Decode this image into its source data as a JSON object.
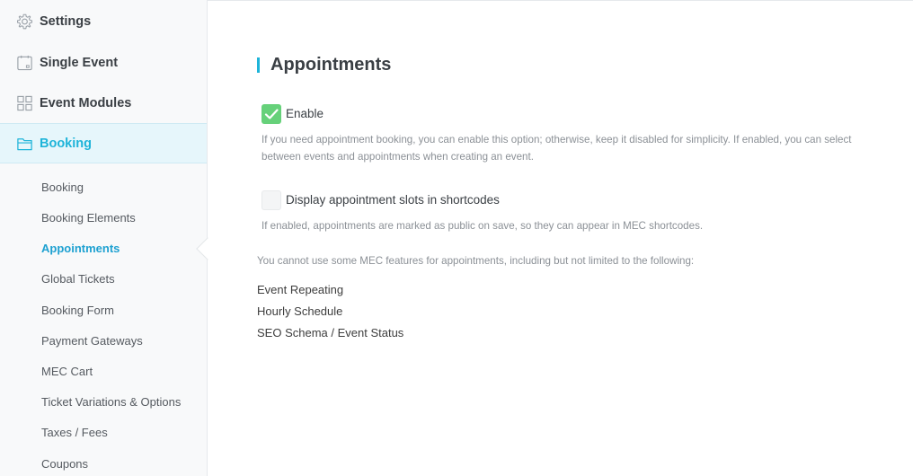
{
  "sidebar": {
    "main_items": [
      {
        "label": "Settings",
        "icon": "gear-icon"
      },
      {
        "label": "Single Event",
        "icon": "calendar-icon"
      },
      {
        "label": "Event Modules",
        "icon": "grid-icon"
      },
      {
        "label": "Booking",
        "icon": "folder-icon"
      }
    ],
    "sub_items": [
      "Booking",
      "Booking Elements",
      "Appointments",
      "Global Tickets",
      "Booking Form",
      "Payment Gateways",
      "MEC Cart",
      "Ticket Variations & Options",
      "Taxes / Fees",
      "Coupons"
    ],
    "active_main": "Booking",
    "active_sub": "Appointments"
  },
  "main": {
    "title": "Appointments",
    "enable": {
      "label": "Enable",
      "checked": true,
      "description": "If you need appointment booking, you can enable this option; otherwise, keep it disabled for simplicity. If enabled, you can select between events and appointments when creating an event."
    },
    "display_slots": {
      "label": "Display appointment slots in shortcodes",
      "checked": false,
      "description": "If enabled, appointments are marked as public on save, so they can appear in MEC shortcodes."
    },
    "note": "You cannot use some MEC features for appointments, including but not limited to the following:",
    "features": [
      "Event Repeating",
      "Hourly Schedule",
      "SEO Schema / Event Status"
    ]
  },
  "colors": {
    "accent": "#1eb4d9",
    "checkbox_checked": "#66d17a",
    "sidebar_bg": "#f8f9fa",
    "active_bg": "#e6f6fb"
  }
}
